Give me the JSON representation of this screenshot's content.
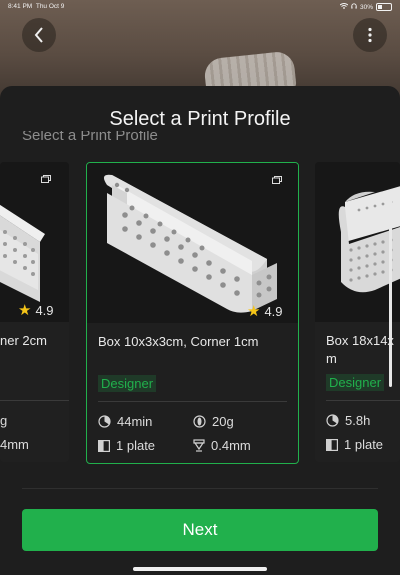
{
  "status_bar": {
    "time": "8:41 PM",
    "date": "Thu Oct 9",
    "battery": "30%"
  },
  "sheet": {
    "title": "Select a Print Profile",
    "ghost_title": "Select a Print Profile"
  },
  "cards": [
    {
      "rating": "4.9",
      "name": "ner 2cm",
      "badge": "",
      "time": "g",
      "weight": "",
      "plates": "4mm",
      "nozzle": ""
    },
    {
      "rating": "4.9",
      "name": "Box 10x3x3cm, Corner 1cm",
      "badge": "Designer",
      "time": "44min",
      "weight": "20g",
      "plates": "1 plate",
      "nozzle": "0.4mm"
    },
    {
      "rating": "",
      "name": "Box 18x14x",
      "name_line2": "m",
      "badge": "Designer",
      "time": "5.8h",
      "weight": "",
      "plates": "1 plate",
      "nozzle": ""
    }
  ],
  "footer": {
    "next_label": "Next"
  },
  "colors": {
    "accent": "#21b04c",
    "star": "#f5c518"
  }
}
